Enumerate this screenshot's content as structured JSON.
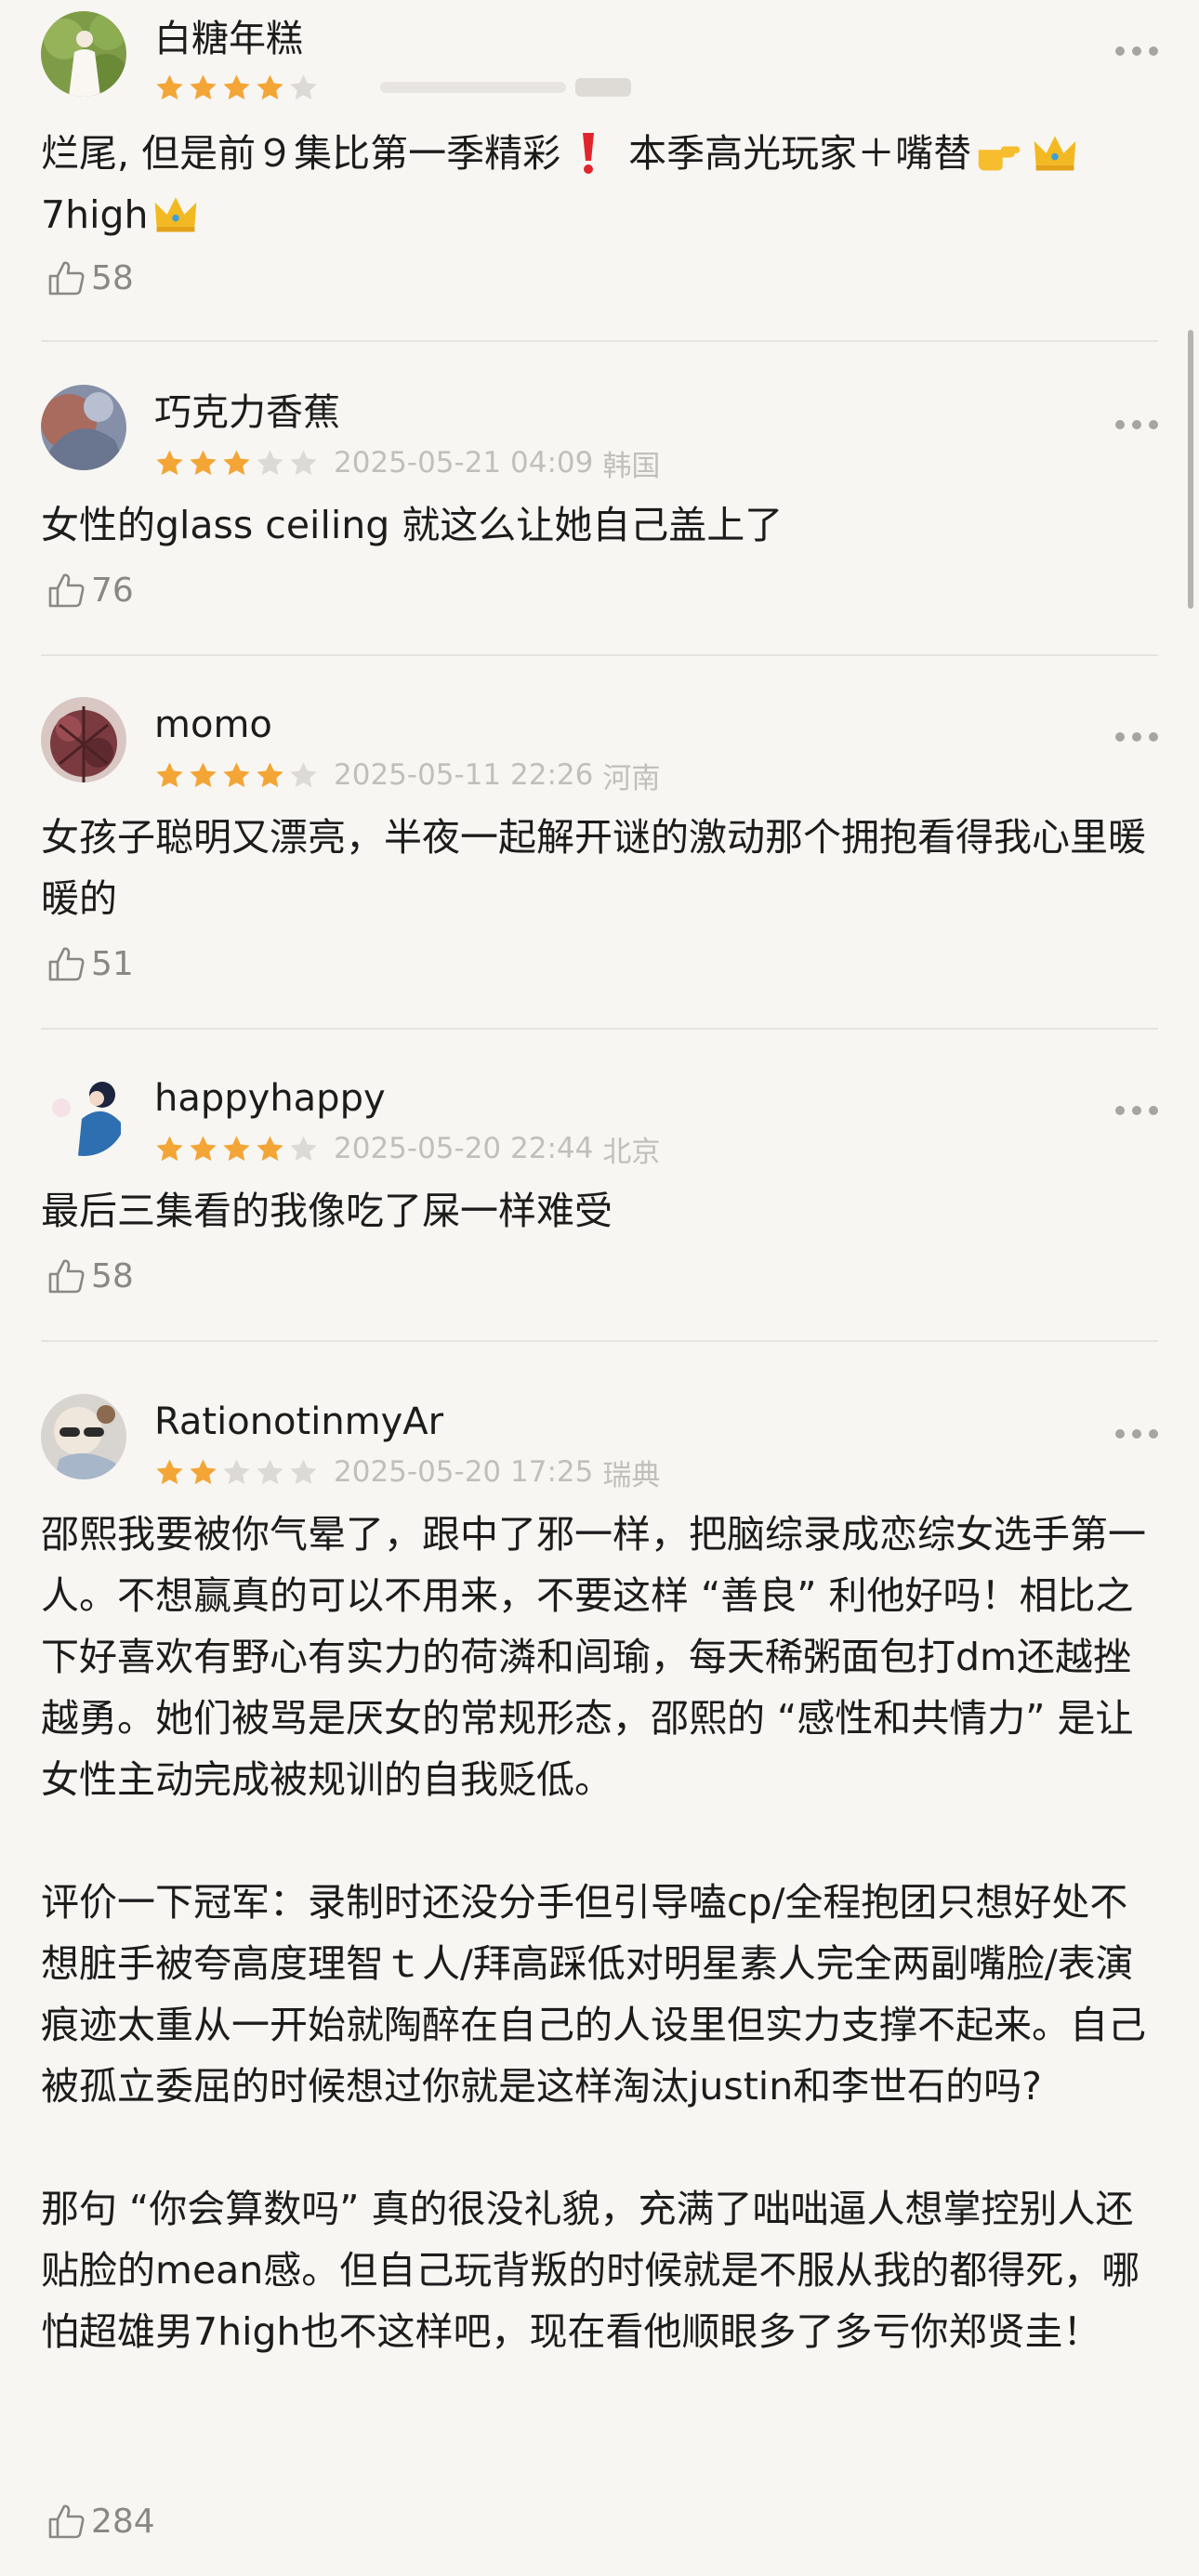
{
  "reviews": [
    {
      "username": "白糖年糕",
      "rating": 4,
      "date": "",
      "location": "",
      "comment": [
        "烂尾, 但是前９集比第一季精彩",
        "本季高光玩家＋嘴替",
        "7high"
      ],
      "likes": "58"
    },
    {
      "username": "巧克力香蕉",
      "rating": 3,
      "date": "2025-05-21 04:09",
      "location": "韩国",
      "comment": [
        "女性的glass ceiling 就这么让她自己盖上了"
      ],
      "likes": "76"
    },
    {
      "username": "momo",
      "rating": 4,
      "date": "2025-05-11 22:26",
      "location": "河南",
      "comment": [
        "女孩子聪明又漂亮，半夜一起解开谜的激动那个拥抱看得我心里暖暖的"
      ],
      "likes": "51"
    },
    {
      "username": "happyhappy",
      "rating": 4,
      "date": "2025-05-20 22:44",
      "location": "北京",
      "comment": [
        "最后三集看的我像吃了屎一样难受"
      ],
      "likes": "58"
    },
    {
      "username": "RationotinmyAr",
      "rating": 2,
      "date": "2025-05-20 17:25",
      "location": "瑞典",
      "comment": [
        "邵熙我要被你气晕了，跟中了邪一样，把脑综录成恋综女选手第一人。不想赢真的可以不用来，不要这样 “善良” 利他好吗！相比之下好喜欢有野心有实力的荷潾和闾瑜，每天稀粥面包打dm还越挫越勇。她们被骂是厌女的常规形态，邵熙的 “感性和共情力” 是让女性主动完成被规训的自我贬低。",
        "评价一下冠军：录制时还没分手但引导嗑cp/全程抱团只想好处不想脏手被夸高度理智ｔ人/拜高踩低对明星素人完全两副嘴脸/表演痕迹太重从一开始就陶醉在自己的人设里但实力支撑不起来。自己被孤立委屈的时候想过你就是这样淘汰justin和李世石的吗?",
        "那句 “你会算数吗” 真的很没礼貌，充满了咄咄逼人想掌控别人还贴脸的mean感。但自己玩背叛的时候就是不服从我的都得死，哪怕超雄男7high也不这样吧，现在看他顺眼多了多亏你郑贤圭！"
      ],
      "likes": "284"
    }
  ],
  "colors": {
    "background": "#f8f6f3",
    "star_filled": "#f3a535",
    "star_empty": "#dcdad7",
    "meta_text": "#c2bfbb",
    "divider": "#e7e4e0"
  },
  "icons": [
    "thumbs-up-icon",
    "more-dots-icon",
    "star-icon",
    "exclamation-emoji",
    "pointing-hand-emoji",
    "crown-emoji"
  ]
}
